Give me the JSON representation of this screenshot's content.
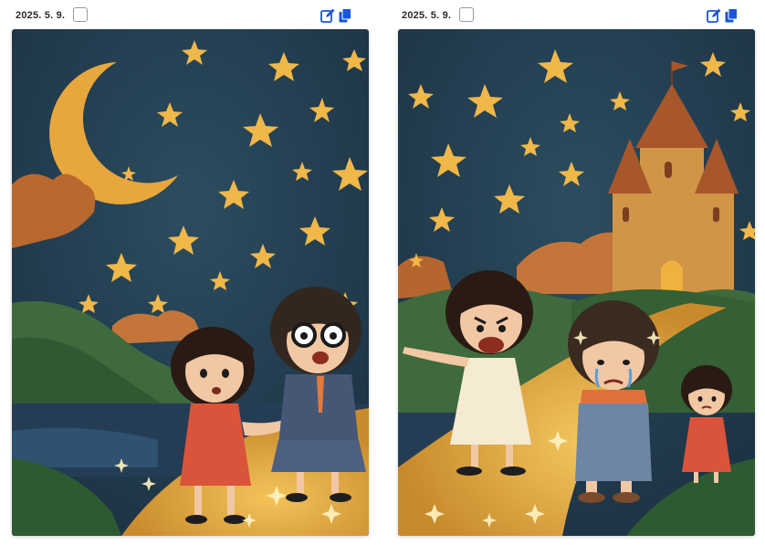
{
  "cards": [
    {
      "date": "2025. 5. 9.",
      "checked": false,
      "edit_icon": "edit-icon",
      "copy_icon": "copy-icon",
      "accent": "#1a56db"
    },
    {
      "date": "2025. 5. 9.",
      "checked": false,
      "edit_icon": "edit-icon",
      "copy_icon": "copy-icon",
      "accent": "#1a56db"
    }
  ]
}
